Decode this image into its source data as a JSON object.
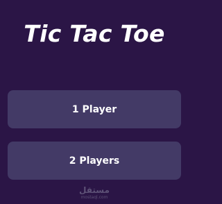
{
  "game": {
    "title": "Tic Tac Toe"
  },
  "menu": {
    "one_player_label": "1 Player",
    "two_players_label": "2 Players"
  },
  "watermark": {
    "main": "مستقل",
    "sub": "mostaql.com"
  },
  "colors": {
    "background": "#2b1546",
    "button": "#433a66",
    "text": "#ffffff",
    "watermark": "#5e5277"
  }
}
